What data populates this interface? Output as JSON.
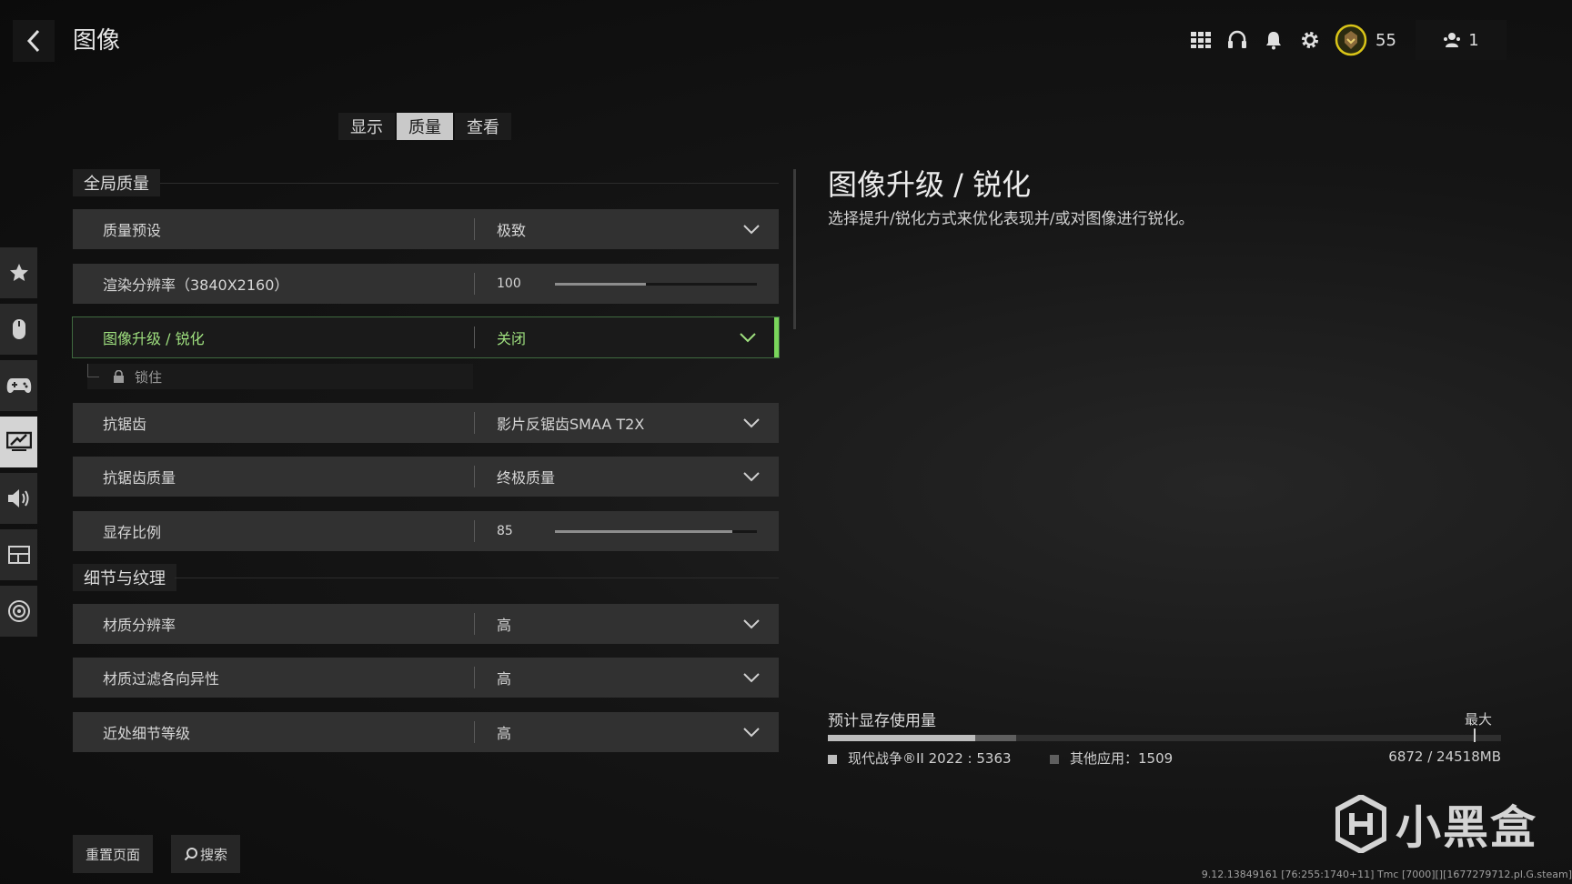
{
  "header": {
    "title": "图像",
    "rank_level": "55",
    "party_count": "1"
  },
  "tabs": [
    {
      "label": "显示"
    },
    {
      "label": "质量"
    },
    {
      "label": "查看"
    }
  ],
  "active_tab": "质量",
  "sections": {
    "global": "全局质量",
    "detail": "细节与纹理"
  },
  "settings": {
    "quality_preset": {
      "label": "质量预设",
      "value": "极致"
    },
    "render_resolution": {
      "label": "渲染分辨率（3840X2160）",
      "value": "100",
      "level": 0.45
    },
    "upscaling": {
      "label": "图像升级 / 锐化",
      "value": "关闭"
    },
    "locked": {
      "label": "锁住"
    },
    "anti_aliasing": {
      "label": "抗锯齿",
      "value": "影片反锯齿SMAA T2X"
    },
    "aa_quality": {
      "label": "抗锯齿质量",
      "value": "终极质量"
    },
    "vram_scale": {
      "label": "显存比例",
      "value": "85",
      "level": 0.88
    },
    "texture_resolution": {
      "label": "材质分辨率",
      "value": "高"
    },
    "texture_filter": {
      "label": "材质过滤各向异性",
      "value": "高"
    },
    "near_detail": {
      "label": "近处细节等级",
      "value": "高"
    }
  },
  "detail_panel": {
    "title": "图像升级 / 锐化",
    "description": "选择提升/锐化方式来优化表现并/或对图像进行锐化。"
  },
  "vram": {
    "title": "预计显存使用量",
    "max_label": "最大",
    "game_label": "现代战争®II 2022 : 5363",
    "other_label": "其他应用：1509",
    "total_label": "6872 / 24518MB",
    "game_mb": 5363,
    "other_mb": 1509,
    "total_mb": 24518,
    "colors": {
      "game": "#bdbdbd",
      "other": "#5f5f5f"
    }
  },
  "buttons": {
    "reset": "重置页面",
    "search": "搜索"
  },
  "watermark": {
    "text": "小黑盒"
  },
  "version": "9.12.13849161 [76:255:1740+11] Tmc [7000][][1677279712.pl.G.steam]",
  "accent_color": "#7ad65b"
}
